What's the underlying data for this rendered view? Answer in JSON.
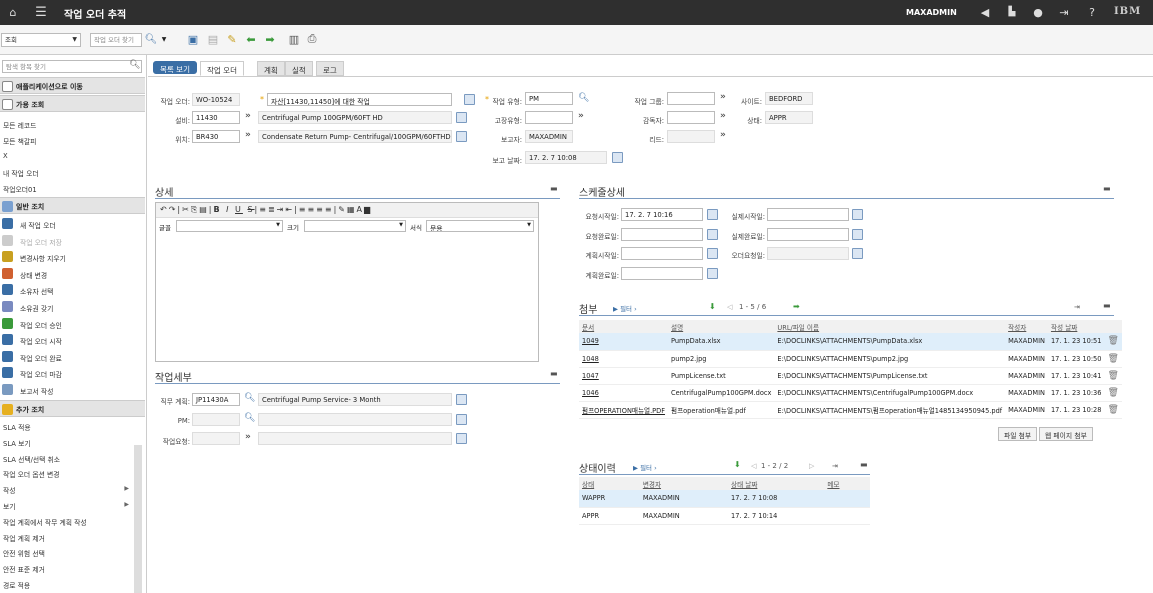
{
  "header": {
    "title": "작업 오더 추적",
    "user": "MAXADMIN",
    "brand": "IBM"
  },
  "toolbar": {
    "query_value": "조회",
    "find_placeholder": "작업 오더 찾기"
  },
  "sidebar": {
    "search_placeholder": "탐색 항목 찾기",
    "goto_label": "애플리케이션으로 이동",
    "available_queries_label": "가용 조회",
    "queries": [
      "모든 레코드",
      "모든 책갈피",
      "X",
      "내 작업 오더",
      "작업오더01"
    ],
    "common_actions_label": "일반 조치",
    "common_actions": [
      {
        "label": "새 작업 오더",
        "icon": "new-record-icon",
        "disabled": false
      },
      {
        "label": "작업 오더 저장",
        "icon": "save-icon",
        "disabled": true
      },
      {
        "label": "변경사항 지우기",
        "icon": "clear-icon",
        "disabled": false
      },
      {
        "label": "상태 변경",
        "icon": "status-icon",
        "disabled": false
      },
      {
        "label": "소유자 선택",
        "icon": "owner-icon",
        "disabled": false
      },
      {
        "label": "소유권 갖기",
        "icon": "ownership-icon",
        "disabled": false
      },
      {
        "label": "작업 오더 승인",
        "icon": "approve-icon",
        "disabled": false
      },
      {
        "label": "작업 오더 시작",
        "icon": "start-icon",
        "disabled": false
      },
      {
        "label": "작업 오더 완료",
        "icon": "complete-icon",
        "disabled": false
      },
      {
        "label": "작업 오더 마감",
        "icon": "close-icon",
        "disabled": false
      },
      {
        "label": "보고서 작성",
        "icon": "report-icon",
        "disabled": false
      }
    ],
    "more_actions_label": "추가 조치",
    "more_actions": [
      {
        "label": "SLA 적용",
        "has_submenu": false
      },
      {
        "label": "SLA 보기",
        "has_submenu": false
      },
      {
        "label": "SLA 선택/선택 취소",
        "has_submenu": false
      },
      {
        "label": "작업 오더 옵션 변경",
        "has_submenu": false
      },
      {
        "label": "작성",
        "has_submenu": true
      },
      {
        "label": "보기",
        "has_submenu": true
      },
      {
        "label": "작업 계획에서 작무 계획 작성",
        "has_submenu": false
      },
      {
        "label": "작업 계획 제거",
        "has_submenu": false
      },
      {
        "label": "안전 위험 선택",
        "has_submenu": false
      },
      {
        "label": "안전 표준 제거",
        "has_submenu": false
      },
      {
        "label": "경로 적용",
        "has_submenu": false
      }
    ]
  },
  "tabs": {
    "list_view": "목록 보기",
    "items": [
      "작업 오더",
      "계획",
      "실적",
      "로그"
    ]
  },
  "form": {
    "wo_label": "작업 오더:",
    "wo_value": "WO-10524",
    "desc_value": "자산[11430,11450]에 대한 작업",
    "asset_label": "설비:",
    "asset_value": "11430",
    "asset_desc": "Centrifugal Pump 100GPM/60FT HD",
    "location_label": "위치:",
    "location_value": "BR430",
    "location_desc": "Condensate Return Pump- Centrifugal/100GPM/60FTHD",
    "worktype_label": "작업 유형:",
    "worktype_value": "PM",
    "failclass_label": "고장유형:",
    "failclass_value": "",
    "reportedby_label": "보고자:",
    "reportedby_value": "MAXADMIN",
    "reportdate_label": "보고 날짜:",
    "reportdate_value": "17. 2. 7 10:08",
    "workgroup_label": "작업 그룹:",
    "workgroup_value": "",
    "supervisor_label": "감독자:",
    "supervisor_value": "",
    "lead_label": "리드:",
    "lead_value": "",
    "site_label": "사이트:",
    "site_value": "BEDFORD",
    "status_label": "상태:",
    "status_value": "APPR"
  },
  "details": {
    "title": "상세",
    "font_label": "글꼴",
    "size_label": "크기",
    "style_label": "서식",
    "style_value": "문용"
  },
  "worksub": {
    "title": "작업세부",
    "jobplan_label": "직무 계획:",
    "jobplan_value": "JP11430A",
    "jobplan_desc": "Centrifugal Pump Service- 3 Month",
    "pm_label": "PM:",
    "pm_value": "",
    "request_label": "작업요청:",
    "request_value": ""
  },
  "schedule": {
    "title": "스케줄상세",
    "fields": [
      {
        "label": "요청시작일:",
        "value": "17. 2. 7 10:16"
      },
      {
        "label": "요청완료일:",
        "value": ""
      },
      {
        "label": "계획시작일:",
        "value": ""
      },
      {
        "label": "계획완료일:",
        "value": ""
      }
    ],
    "fields2": [
      {
        "label": "실제시작일:",
        "value": ""
      },
      {
        "label": "실제완료일:",
        "value": ""
      },
      {
        "label": "오더요청일:",
        "value": ""
      }
    ]
  },
  "attachments": {
    "title": "첨부",
    "filter_label": "필터",
    "pager": "1 - 5 / 6",
    "columns": [
      "문서",
      "설명",
      "URL/파일 이름",
      "작성자",
      "작성 날짜"
    ],
    "rows": [
      {
        "doc": "1049",
        "desc": "PumpData.xlsx",
        "url": "E:\\DOCLINKS\\ATTACHMENTS\\PumpData.xlsx",
        "by": "MAXADMIN",
        "date": "17. 1. 23 10:51"
      },
      {
        "doc": "1048",
        "desc": "pump2.jpg",
        "url": "E:\\DOCLINKS\\ATTACHMENTS\\pump2.jpg",
        "by": "MAXADMIN",
        "date": "17. 1. 23 10:50"
      },
      {
        "doc": "1047",
        "desc": "PumpLicense.txt",
        "url": "E:\\DOCLINKS\\ATTACHMENTS\\PumpLicense.txt",
        "by": "MAXADMIN",
        "date": "17. 1. 23 10:41"
      },
      {
        "doc": "1046",
        "desc": "CentrifugalPump100GPM.docx",
        "url": "E:\\DOCLINKS\\ATTACHMENTS\\CentrifugalPump100GPM.docx",
        "by": "MAXADMIN",
        "date": "17. 1. 23 10:36"
      },
      {
        "doc": "펌프OPERATION매뉴얼.PDF",
        "desc": "펌프operation매뉴얼.pdf",
        "url": "E:\\DOCLINKS\\ATTACHMENTS\\펌프operation매뉴얼1485134950945.pdf",
        "by": "MAXADMIN",
        "date": "17. 1. 23 10:28"
      }
    ],
    "file_button": "파일 첨부",
    "web_button": "웹 페이지 첨부"
  },
  "history": {
    "title": "상태이력",
    "filter_label": "필터",
    "pager": "1 - 2 / 2",
    "columns": [
      "상태",
      "변경자",
      "상태 날짜",
      "메모"
    ],
    "rows": [
      {
        "status": "WAPPR",
        "by": "MAXADMIN",
        "date": "17. 2. 7 10:08",
        "memo": ""
      },
      {
        "status": "APPR",
        "by": "MAXADMIN",
        "date": "17. 2. 7 10:14",
        "memo": ""
      }
    ]
  }
}
